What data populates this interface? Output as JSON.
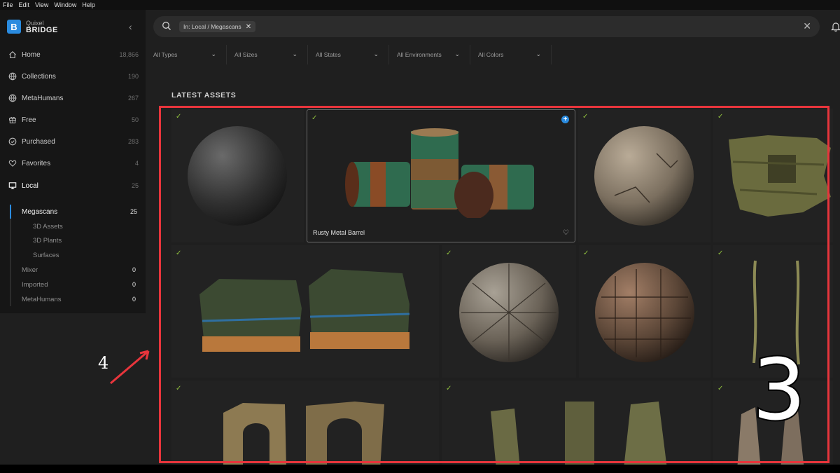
{
  "menu": [
    "File",
    "Edit",
    "View",
    "Window",
    "Help"
  ],
  "brand": {
    "line1": "Quixel",
    "line2": "BRIDGE",
    "logo_letter": "B",
    "accent": "#2a8bdf"
  },
  "sidebar": {
    "items": [
      {
        "label": "Home",
        "count": "18,866",
        "icon": "home-icon"
      },
      {
        "label": "Collections",
        "count": "190",
        "icon": "globe-icon"
      },
      {
        "label": "MetaHumans",
        "count": "267",
        "icon": "globe-icon"
      },
      {
        "label": "Free",
        "count": "50",
        "icon": "gift-icon"
      },
      {
        "label": "Purchased",
        "count": "283",
        "icon": "check-circle-icon"
      },
      {
        "label": "Favorites",
        "count": "4",
        "icon": "heart-icon"
      },
      {
        "label": "Local",
        "count": "25",
        "icon": "monitor-icon"
      }
    ],
    "sub_items": [
      {
        "label": "Megascans",
        "count": "25"
      },
      {
        "label": "3D Assets"
      },
      {
        "label": "3D Plants"
      },
      {
        "label": "Surfaces"
      },
      {
        "label": "Mixer",
        "count": "0"
      },
      {
        "label": "Imported",
        "count": "0"
      },
      {
        "label": "MetaHumans",
        "count": "0"
      }
    ]
  },
  "search": {
    "chip": "In: Local / Megascans"
  },
  "filters": [
    "All Types",
    "All Sizes",
    "All States",
    "All Environments",
    "All Colors"
  ],
  "section_title": "LATEST ASSETS",
  "grid": {
    "hover_asset_name": "Rusty Metal Barrel",
    "check_color": "#8fbf3e"
  },
  "annotations": {
    "arrow_label": "4",
    "big_label": "3",
    "frame_color": "#e8353c"
  }
}
